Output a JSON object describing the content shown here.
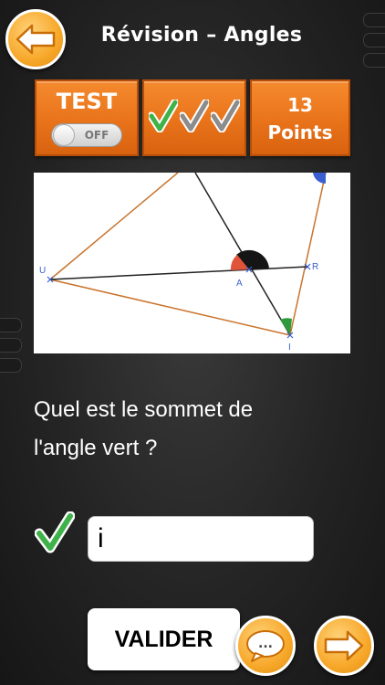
{
  "header": {
    "title": "Révision – Angles",
    "back_icon": "arrow-left-icon"
  },
  "status": {
    "test_label": "TEST",
    "toggle_text": "OFF",
    "toggle_state": "off",
    "checks": [
      {
        "icon": "checkmark-icon",
        "color": "#3fb34a"
      },
      {
        "icon": "checkmark-icon",
        "color": "#8c8c8c"
      },
      {
        "icon": "checkmark-icon",
        "color": "#8c8c8c"
      }
    ],
    "points_value": "13",
    "points_label": "Points"
  },
  "figure": {
    "labels": {
      "u": "U",
      "a": "A",
      "r": "R",
      "i": "I"
    }
  },
  "question": {
    "line1": "Quel est le sommet de",
    "line2": "l'angle vert ?"
  },
  "answer": {
    "value": "i",
    "check_icon": "checkmark-icon",
    "check_color": "#3fb34a"
  },
  "buttons": {
    "valider_label": "VALIDER",
    "chat_label": "...",
    "chat_icon": "speech-bubble-icon",
    "next_icon": "arrow-right-icon"
  },
  "colors": {
    "accent_orange": "#ef7d22",
    "panel_border": "#b64e0a"
  }
}
